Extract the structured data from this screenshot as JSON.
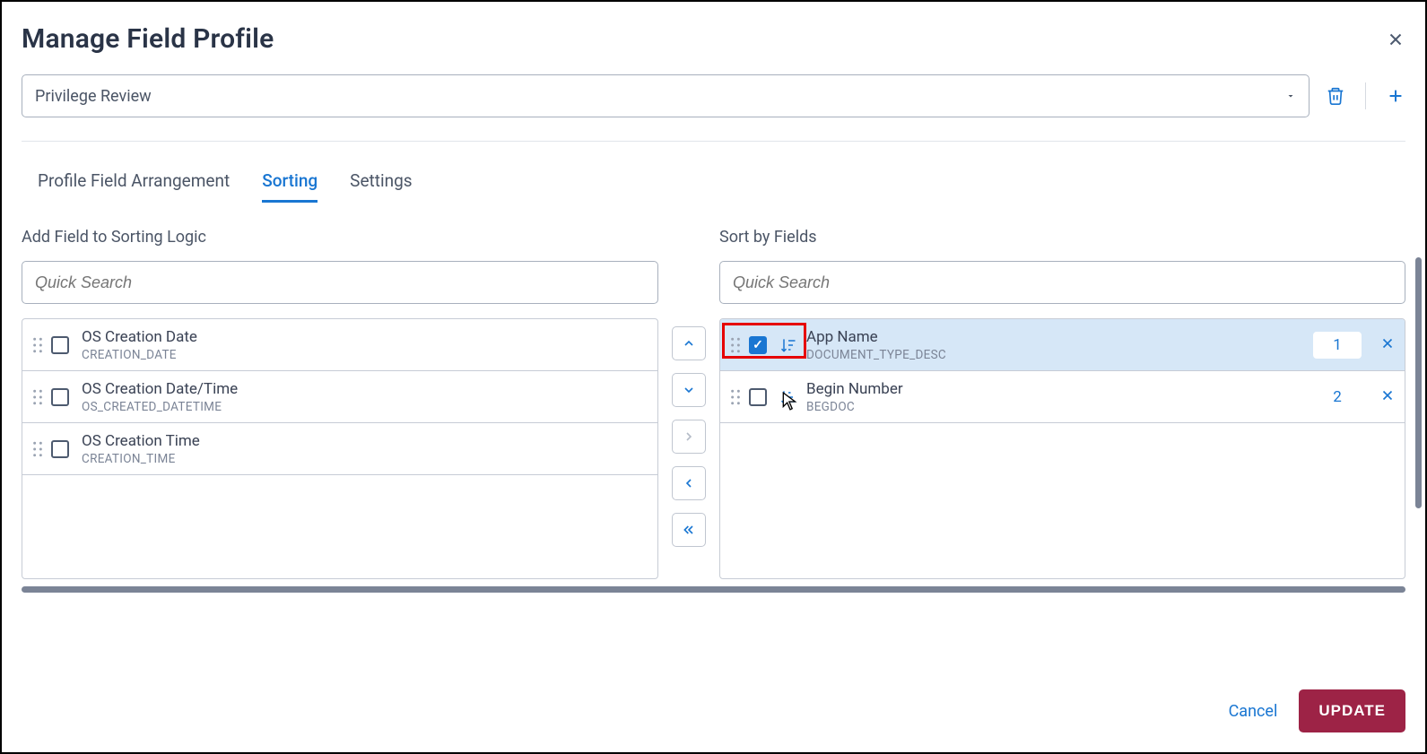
{
  "header": {
    "title": "Manage Field Profile"
  },
  "profile": {
    "selected": "Privilege Review"
  },
  "tabs": [
    {
      "label": "Profile Field Arrangement",
      "active": false
    },
    {
      "label": "Sorting",
      "active": true
    },
    {
      "label": "Settings",
      "active": false
    }
  ],
  "left": {
    "label": "Add Field to Sorting Logic",
    "search_placeholder": "Quick Search",
    "items": [
      {
        "title": "OS Creation Date",
        "sub": "CREATION_DATE"
      },
      {
        "title": "OS Creation Date/Time",
        "sub": "OS_CREATED_DATETIME"
      },
      {
        "title": "OS Creation Time",
        "sub": "CREATION_TIME"
      }
    ]
  },
  "right": {
    "label": "Sort by Fields",
    "search_placeholder": "Quick Search",
    "items": [
      {
        "title": "App Name",
        "sub": "DOCUMENT_TYPE_DESC",
        "order": "1",
        "checked": true,
        "sort": "desc",
        "selected": true
      },
      {
        "title": "Begin Number",
        "sub": "BEGDOC",
        "order": "2",
        "checked": false,
        "sort": "asc",
        "selected": false
      }
    ]
  },
  "footer": {
    "cancel": "Cancel",
    "update": "UPDATE"
  }
}
